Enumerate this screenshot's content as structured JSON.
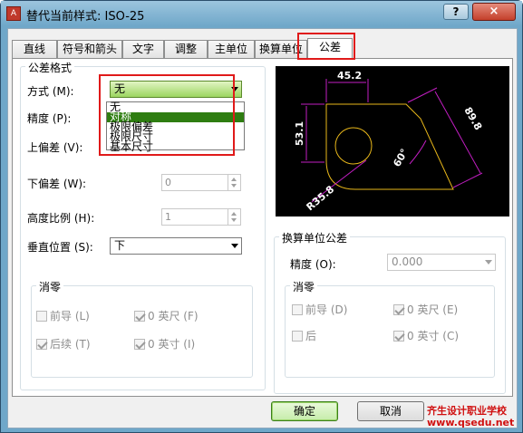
{
  "window": {
    "title": "替代当前样式: ISO-25",
    "help_label": "?",
    "close_label": "×"
  },
  "tabs": [
    "直线",
    "符号和箭头",
    "文字",
    "调整",
    "主单位",
    "换算单位",
    "公差"
  ],
  "tolerance_format": {
    "group_title": "公差格式",
    "method_label": "方式 (M):",
    "method_value": "无",
    "method_options": [
      "无",
      "对称",
      "极限偏差",
      "极限尺寸",
      "基本尺寸"
    ],
    "precision_label": "精度 (P):",
    "upper_label": "上偏差 (V):",
    "lower_label": "下偏差 (W):",
    "lower_value": "0",
    "height_label": "高度比例 (H):",
    "height_value": "1",
    "vpos_label": "垂直位置 (S):",
    "vpos_value": "下"
  },
  "zero_left": {
    "title": "消零",
    "leading": "前导 (L)",
    "trailing": "后续 (T)",
    "feet": "0 英尺 (F)",
    "inches": "0 英寸 (I)",
    "leading_checked": false,
    "trailing_checked": true,
    "feet_checked": true,
    "inches_checked": true
  },
  "alt_tol": {
    "group_title": "换算单位公差",
    "precision_label": "精度 (O):",
    "precision_value": "0.000"
  },
  "zero_right": {
    "title": "消零",
    "leading": "前导 (D)",
    "trailing": "后",
    "feet": "0 英尺 (E)",
    "inches": "0 英寸 (C)",
    "leading_checked": false,
    "trailing_checked": false,
    "feet_checked": true,
    "inches_checked": true
  },
  "preview": {
    "dim1": "45.2",
    "dim2": "53.1",
    "dim3": "89.8",
    "angle": "60°",
    "radius": "R35.8"
  },
  "buttons": {
    "ok": "确定",
    "cancel": "取消"
  },
  "watermark": {
    "line1": "齐生设计职业学校",
    "line2": "www.qsedu.net"
  },
  "colors": {
    "accent": "#9cd560",
    "highlight": "#e01a1a",
    "preview_bg": "#000000"
  }
}
